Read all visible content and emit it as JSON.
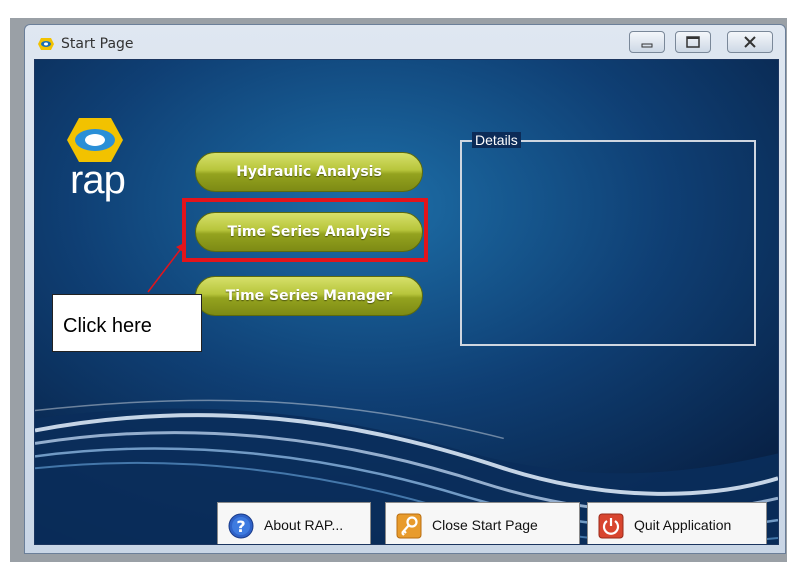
{
  "window": {
    "title": "Start Page",
    "controls": [
      "minimize",
      "maximize",
      "close"
    ]
  },
  "logo": {
    "text": "rap",
    "colors": {
      "accent_yellow": "#f2c200",
      "accent_blue": "#2a8fd7"
    }
  },
  "menu": {
    "buttons": [
      {
        "label": "Hydraulic Analysis"
      },
      {
        "label": "Time Series Analysis"
      },
      {
        "label": "Time Series Manager"
      }
    ]
  },
  "details": {
    "legend": "Details"
  },
  "footer": {
    "about_label": "About RAP...",
    "close_label": "Close Start Page",
    "quit_label": "Quit Application"
  },
  "annotation": {
    "text": "Click here",
    "highlight_color": "#e3141b"
  },
  "icons": {
    "app": "rap-logo-icon",
    "about": "help-icon",
    "close": "key-icon",
    "quit": "power-icon"
  }
}
